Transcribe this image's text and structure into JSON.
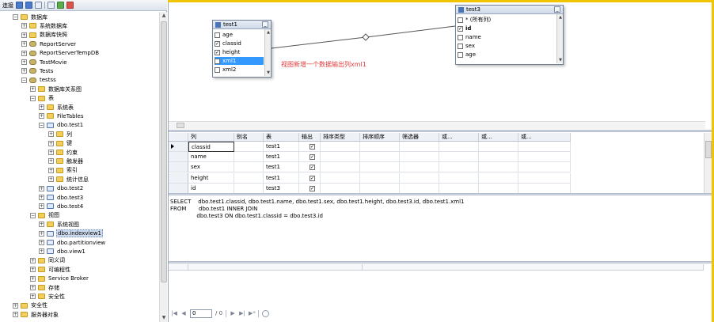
{
  "object_explorer": {
    "toolbar": {
      "connect_label": "连接"
    },
    "tree": [
      {
        "label": "数据库",
        "depth": 1,
        "expander": "−",
        "icon": "folder"
      },
      {
        "label": "系统数据库",
        "depth": 2,
        "expander": "+",
        "icon": "folder"
      },
      {
        "label": "数据库快照",
        "depth": 2,
        "expander": "+",
        "icon": "folder"
      },
      {
        "label": "ReportServer",
        "depth": 2,
        "expander": "+",
        "icon": "db"
      },
      {
        "label": "ReportServerTempDB",
        "depth": 2,
        "expander": "+",
        "icon": "db"
      },
      {
        "label": "TestMovie",
        "depth": 2,
        "expander": "+",
        "icon": "db"
      },
      {
        "label": "Tests",
        "depth": 2,
        "expander": "+",
        "icon": "db"
      },
      {
        "label": "testss",
        "depth": 2,
        "expander": "−",
        "icon": "db"
      },
      {
        "label": "数据库关系图",
        "depth": 3,
        "expander": "+",
        "icon": "folder"
      },
      {
        "label": "表",
        "depth": 3,
        "expander": "−",
        "icon": "folder"
      },
      {
        "label": "系统表",
        "depth": 4,
        "expander": "+",
        "icon": "folder"
      },
      {
        "label": "FileTables",
        "depth": 4,
        "expander": "+",
        "icon": "folder"
      },
      {
        "label": "dbo.test1",
        "depth": 4,
        "expander": "−",
        "icon": "table"
      },
      {
        "label": "列",
        "depth": 5,
        "expander": "+",
        "icon": "folder"
      },
      {
        "label": "键",
        "depth": 5,
        "expander": "+",
        "icon": "folder"
      },
      {
        "label": "约束",
        "depth": 5,
        "expander": "+",
        "icon": "folder"
      },
      {
        "label": "触发器",
        "depth": 5,
        "expander": "+",
        "icon": "folder"
      },
      {
        "label": "索引",
        "depth": 5,
        "expander": "+",
        "icon": "folder"
      },
      {
        "label": "统计信息",
        "depth": 5,
        "expander": "+",
        "icon": "folder"
      },
      {
        "label": "dbo.test2",
        "depth": 4,
        "expander": "+",
        "icon": "table"
      },
      {
        "label": "dbo.test3",
        "depth": 4,
        "expander": "+",
        "icon": "table"
      },
      {
        "label": "dbo.test4",
        "depth": 4,
        "expander": "+",
        "icon": "table"
      },
      {
        "label": "视图",
        "depth": 3,
        "expander": "−",
        "icon": "folder"
      },
      {
        "label": "系统视图",
        "depth": 4,
        "expander": "+",
        "icon": "folder"
      },
      {
        "label": "dbo.indexview1",
        "depth": 4,
        "expander": "+",
        "icon": "view",
        "selected": true
      },
      {
        "label": "dbo.partitionview",
        "depth": 4,
        "expander": "+",
        "icon": "view"
      },
      {
        "label": "dbo.view1",
        "depth": 4,
        "expander": "+",
        "icon": "view"
      },
      {
        "label": "同义词",
        "depth": 3,
        "expander": "+",
        "icon": "folder"
      },
      {
        "label": "可编程性",
        "depth": 3,
        "expander": "+",
        "icon": "folder"
      },
      {
        "label": "Service Broker",
        "depth": 3,
        "expander": "+",
        "icon": "folder"
      },
      {
        "label": "存储",
        "depth": 3,
        "expander": "+",
        "icon": "folder"
      },
      {
        "label": "安全性",
        "depth": 3,
        "expander": "+",
        "icon": "folder"
      },
      {
        "label": "安全性",
        "depth": 1,
        "expander": "+",
        "icon": "folder"
      },
      {
        "label": "服务器对象",
        "depth": 1,
        "expander": "+",
        "icon": "folder"
      }
    ]
  },
  "diagram": {
    "tables": [
      {
        "name": "test1",
        "rows": [
          {
            "label": "age",
            "checked": false,
            "bold": false,
            "selected": false
          },
          {
            "label": "classid",
            "checked": true,
            "bold": false,
            "selected": false
          },
          {
            "label": "height",
            "checked": true,
            "bold": false,
            "selected": false
          },
          {
            "label": "xml1",
            "checked": true,
            "bold": false,
            "selected": true
          },
          {
            "label": "xml2",
            "checked": false,
            "bold": false,
            "selected": false
          }
        ]
      },
      {
        "name": "test3",
        "rows": [
          {
            "label": "* (所有列)",
            "checked": false,
            "bold": false,
            "selected": false
          },
          {
            "label": "id",
            "checked": true,
            "bold": true,
            "selected": false
          },
          {
            "label": "name",
            "checked": false,
            "bold": false,
            "selected": false
          },
          {
            "label": "sex",
            "checked": false,
            "bold": false,
            "selected": false
          },
          {
            "label": "age",
            "checked": false,
            "bold": false,
            "selected": false
          }
        ]
      }
    ],
    "annotation": "视图新增一个数据输出列xml1"
  },
  "criteria_grid": {
    "headers": [
      "列",
      "别名",
      "表",
      "输出",
      "排序类型",
      "排序顺序",
      "筛选器",
      "或...",
      "或...",
      "或..."
    ],
    "rows": [
      {
        "column": "classid",
        "alias": "",
        "table": "test1",
        "output": true
      },
      {
        "column": "name",
        "alias": "",
        "table": "test1",
        "output": true
      },
      {
        "column": "sex",
        "alias": "",
        "table": "test1",
        "output": true
      },
      {
        "column": "height",
        "alias": "",
        "table": "test1",
        "output": true
      },
      {
        "column": "id",
        "alias": "",
        "table": "test3",
        "output": true
      }
    ]
  },
  "sql_pane": {
    "lines": [
      "SELECT    dbo.test1.classid, dbo.test1.name, dbo.test1.sex, dbo.test1.height, dbo.test3.id, dbo.test1.xml1",
      "FROM       dbo.test1 INNER JOIN",
      "               dbo.test3 ON dbo.test1.classid = dbo.test3.id"
    ]
  },
  "navigator": {
    "current": "0",
    "total": "/ 0"
  }
}
